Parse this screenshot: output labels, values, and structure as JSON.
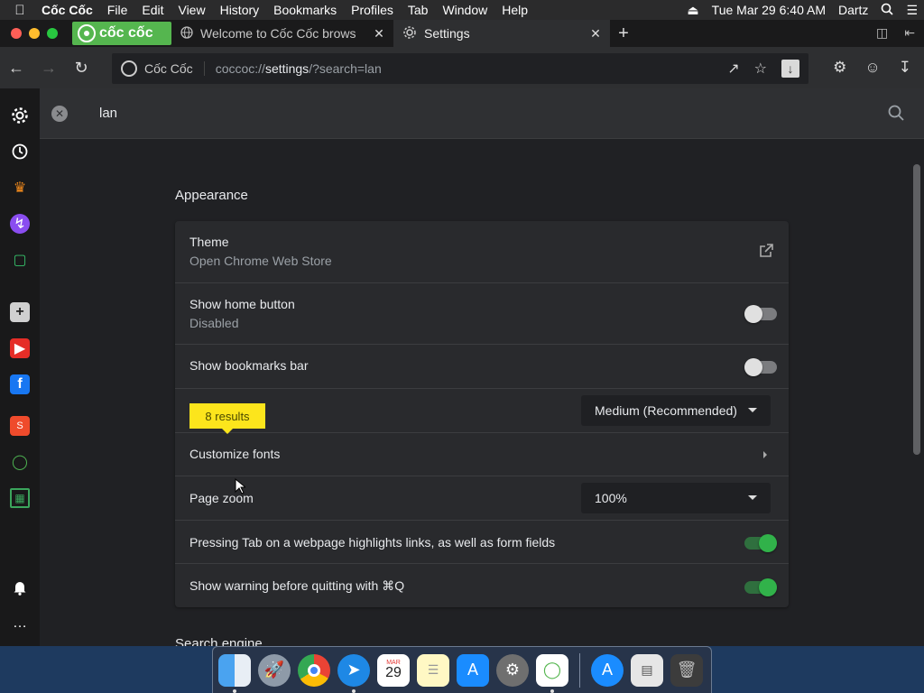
{
  "menubar": {
    "app_name": "Cốc Cốc",
    "items": [
      "File",
      "Edit",
      "View",
      "History",
      "Bookmarks",
      "Profiles",
      "Tab",
      "Window",
      "Help"
    ],
    "datetime": "Tue Mar 29  6:40 AM",
    "user": "Dartz"
  },
  "tabs": {
    "brand_label": "cốc cốc",
    "inactive_title": "Welcome to Cốc Cốc brows",
    "active_title": "Settings"
  },
  "omnibox": {
    "site_name": "Cốc Cốc",
    "url_prefix": "coccoc://",
    "url_host": "settings",
    "url_suffix": "/?search=lan"
  },
  "search": {
    "query": "lan"
  },
  "appearance": {
    "section_title": "Appearance",
    "theme_label": "Theme",
    "theme_sub": "Open Chrome Web Store",
    "home_button_label": "Show home button",
    "home_button_sub": "Disabled",
    "home_button_on": false,
    "bookmarks_bar_label": "Show bookmarks bar",
    "bookmarks_bar_on": false,
    "results_badge": "8 results",
    "font_size_value": "Medium (Recommended)",
    "customize_fonts_label": "Customize fonts",
    "page_zoom_label": "Page zoom",
    "page_zoom_value": "100%",
    "tab_highlight_label": "Pressing Tab on a webpage highlights links, as well as form fields",
    "tab_highlight_on": true,
    "quit_warning_label": "Show warning before quitting with ⌘Q",
    "quit_warning_on": true
  },
  "next_section_title": "Search engine",
  "dock": {
    "calendar_month": "MAR",
    "calendar_day": "29"
  },
  "colors": {
    "brand_green": "#55b64f",
    "toggle_on": "#31b24a",
    "badge_yellow": "#fce51c"
  }
}
